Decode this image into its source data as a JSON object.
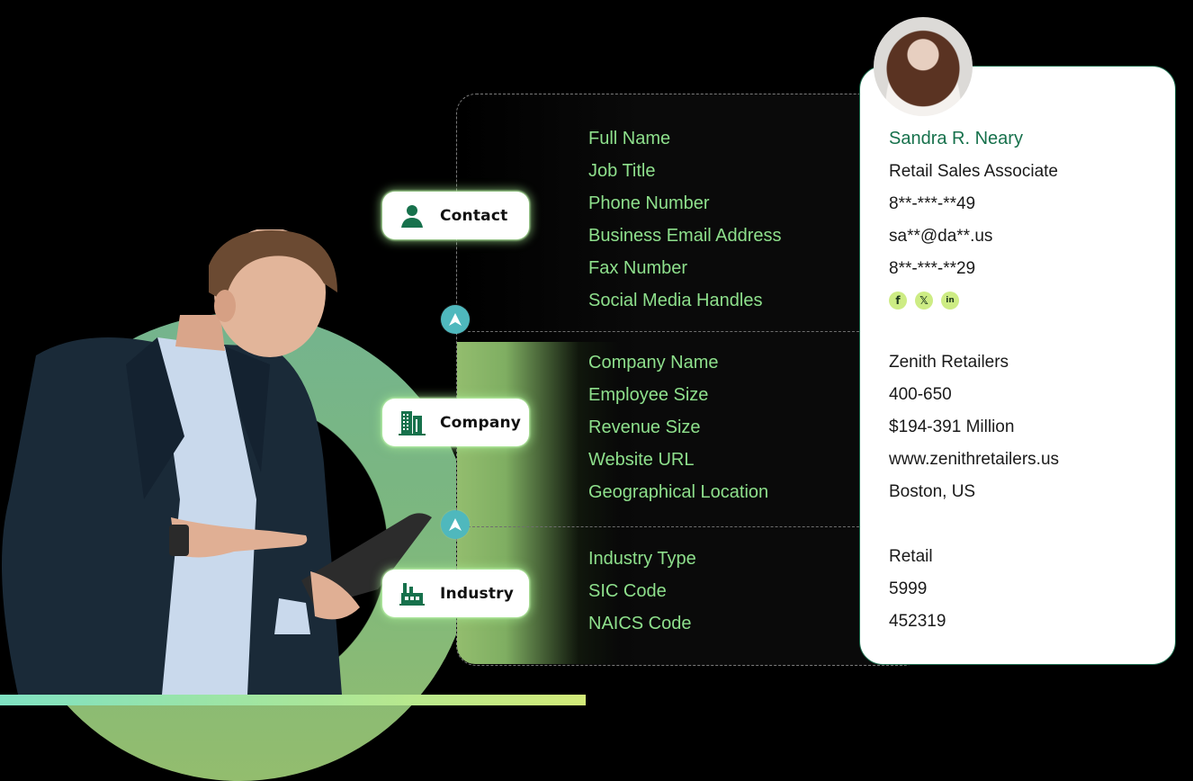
{
  "categories": [
    {
      "label": "Contact",
      "icon": "person-icon"
    },
    {
      "label": "Company",
      "icon": "building-icon"
    },
    {
      "label": "Industry",
      "icon": "factory-icon"
    }
  ],
  "fields": {
    "contact": [
      "Full Name",
      "Job Title",
      "Phone Number",
      "Business Email Address",
      "Fax Number",
      "Social Media Handles"
    ],
    "company": [
      "Company Name",
      "Employee Size",
      "Revenue Size",
      "Website URL",
      "Geographical Location"
    ],
    "industry": [
      "Industry Type",
      "SIC Code",
      "NAICS Code"
    ]
  },
  "profile": {
    "name": "Sandra R. Neary",
    "job_title": "Retail Sales Associate",
    "phone": "8**-***-**49",
    "email": "sa**@da**.us",
    "fax": "8**-***-**29",
    "social": [
      {
        "icon": "facebook-icon",
        "glyph": "f"
      },
      {
        "icon": "x-twitter-icon",
        "glyph": "𝕏"
      },
      {
        "icon": "linkedin-icon",
        "glyph": "in"
      }
    ],
    "company_name": "Zenith Retailers",
    "employee_size": "400-650",
    "revenue_size": "$194-391 Million",
    "website": "www.zenithretailers.us",
    "location": "Boston, US",
    "industry_type": "Retail",
    "sic_code": "5999",
    "naics_code": "452319"
  },
  "colors": {
    "field_label": "#8ee08c",
    "accent_green": "#17714c",
    "node_teal": "#4fb8bd",
    "social_bg": "#cdec84"
  }
}
